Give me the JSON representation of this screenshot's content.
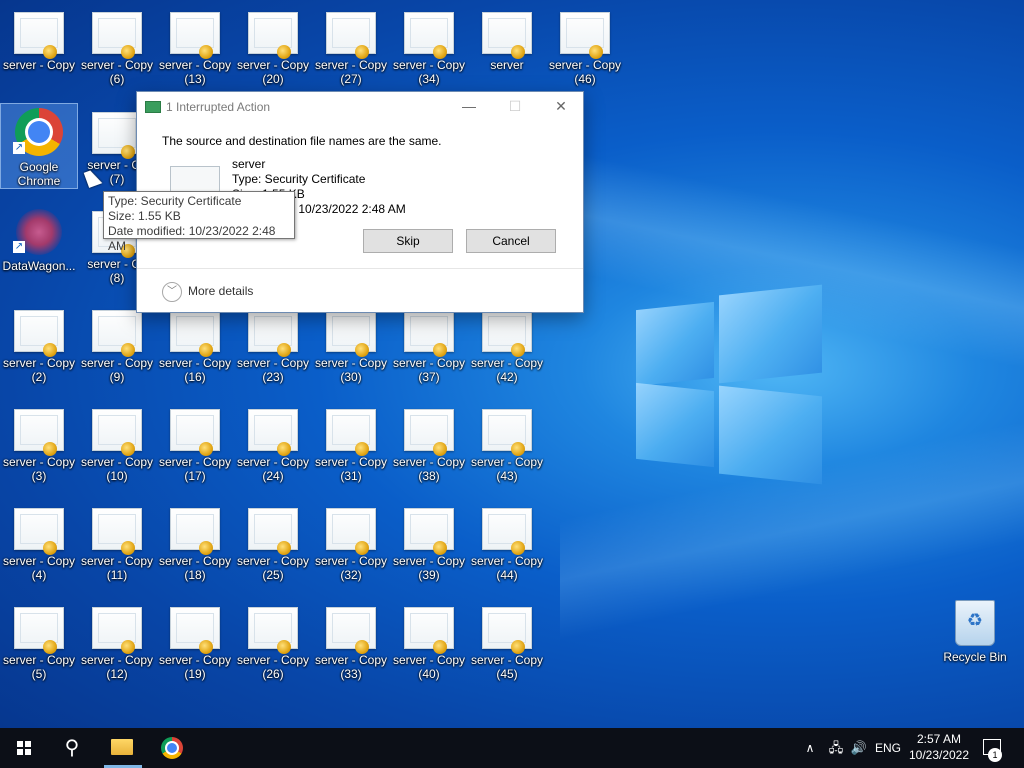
{
  "desktop": {
    "icons": [
      {
        "label": "server - Copy",
        "sub": ""
      },
      {
        "label": "server - Copy",
        "sub": "(6)"
      },
      {
        "label": "server - Copy",
        "sub": "(13)"
      },
      {
        "label": "server - Copy",
        "sub": "(20)"
      },
      {
        "label": "server - Copy",
        "sub": "(27)"
      },
      {
        "label": "server - Copy",
        "sub": "(34)"
      },
      {
        "label": "server",
        "sub": ""
      },
      {
        "label": "server - Copy",
        "sub": "(46)"
      },
      {
        "label": "Google",
        "sub": "Chrome"
      },
      {
        "label": "server - Co",
        "sub": "(7)"
      },
      {
        "label": "DataWagon...",
        "sub": ""
      },
      {
        "label": "server - Co",
        "sub": "(8)"
      },
      {
        "label": "server - Copy",
        "sub": "(2)"
      },
      {
        "label": "server - Copy",
        "sub": "(9)"
      },
      {
        "label": "server - Copy",
        "sub": "(16)"
      },
      {
        "label": "server - Copy",
        "sub": "(23)"
      },
      {
        "label": "server - Copy",
        "sub": "(30)"
      },
      {
        "label": "server - Copy",
        "sub": "(37)"
      },
      {
        "label": "server - Copy",
        "sub": "(42)"
      },
      {
        "label": "server - Copy",
        "sub": "(3)"
      },
      {
        "label": "server - Copy",
        "sub": "(10)"
      },
      {
        "label": "server - Copy",
        "sub": "(17)"
      },
      {
        "label": "server - Copy",
        "sub": "(24)"
      },
      {
        "label": "server - Copy",
        "sub": "(31)"
      },
      {
        "label": "server - Copy",
        "sub": "(38)"
      },
      {
        "label": "server - Copy",
        "sub": "(43)"
      },
      {
        "label": "server - Copy",
        "sub": "(4)"
      },
      {
        "label": "server - Copy",
        "sub": "(11)"
      },
      {
        "label": "server - Copy",
        "sub": "(18)"
      },
      {
        "label": "server - Copy",
        "sub": "(25)"
      },
      {
        "label": "server - Copy",
        "sub": "(32)"
      },
      {
        "label": "server - Copy",
        "sub": "(39)"
      },
      {
        "label": "server - Copy",
        "sub": "(44)"
      },
      {
        "label": "server - Copy",
        "sub": "(5)"
      },
      {
        "label": "server - Copy",
        "sub": "(12)"
      },
      {
        "label": "server - Copy",
        "sub": "(19)"
      },
      {
        "label": "server - Copy",
        "sub": "(26)"
      },
      {
        "label": "server - Copy",
        "sub": "(33)"
      },
      {
        "label": "server - Copy",
        "sub": "(40)"
      },
      {
        "label": "server - Copy",
        "sub": "(45)"
      }
    ],
    "recycle_bin": {
      "label": "Recycle Bin"
    }
  },
  "dialog": {
    "title": "1 Interrupted Action",
    "message": "The source and destination file names are the same.",
    "file_name": "server",
    "file_type": "Type: Security Certificate",
    "file_size": "Size: 1.55 KB",
    "file_date": "d: 10/23/2022 2:48 AM",
    "skip_label": "Skip",
    "cancel_label": "Cancel",
    "more_details_label": "More details",
    "minimize_glyph": "—",
    "maximize_glyph": "☐",
    "close_glyph": "✕"
  },
  "tooltip": {
    "type": "Type: Security Certificate",
    "size": "Size: 1.55 KB",
    "date": "Date modified: 10/23/2022 2:48 AM"
  },
  "taskbar": {
    "search_glyph": "⚲",
    "tray_chevron": "∧",
    "network_glyph": "🖧",
    "volume_glyph": "🔊",
    "language": "ENG",
    "time": "2:57 AM",
    "date": "10/23/2022",
    "notification_count": "1"
  }
}
